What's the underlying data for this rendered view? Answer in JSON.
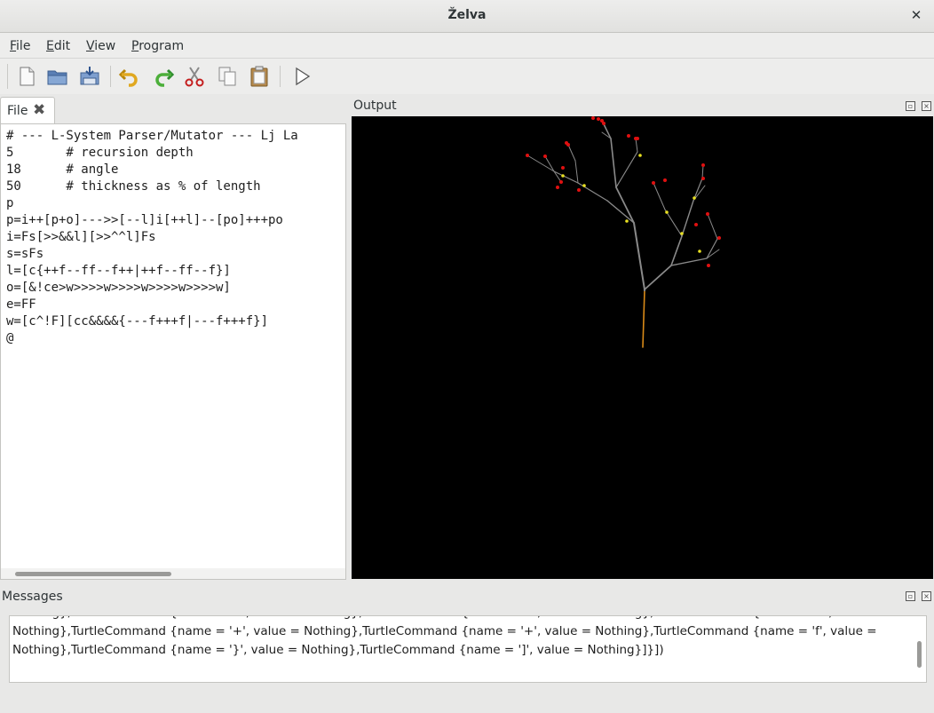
{
  "window": {
    "title": "Želva",
    "close_glyph": "✕"
  },
  "menu": [
    {
      "label": "File",
      "mnemonic": "F",
      "rest": "ile"
    },
    {
      "label": "Edit",
      "mnemonic": "E",
      "rest": "dit"
    },
    {
      "label": "View",
      "mnemonic": "V",
      "rest": "iew"
    },
    {
      "label": "Program",
      "mnemonic": "P",
      "rest": "rogram"
    }
  ],
  "toolbar": {
    "buttons": [
      "new-file-icon",
      "open-folder-icon",
      "save-icon",
      "undo-icon",
      "redo-icon",
      "cut-icon",
      "copy-icon",
      "paste-icon",
      "run-icon"
    ]
  },
  "editor": {
    "tab_label": "File",
    "tab_close": "✖",
    "lines": [
      "# --- L-System Parser/Mutator --- Lj La",
      "5       # recursion depth",
      "18      # angle",
      "50      # thickness as % of length",
      "p",
      "p=i++[p+o]--->>[--l]i[++l]--[po]+++po",
      "i=Fs[>>&&l][>>^^l]Fs",
      "s=sFs",
      "l=[c{++f--ff--f++|++f--ff--f}]",
      "o=[&!ce>w>>>>w>>>>w>>>>w>>>>w]",
      "e=FF",
      "w=[c^!F][cc&&&&{---f+++f|---f+++f}]",
      "@"
    ]
  },
  "output": {
    "title": "Output"
  },
  "messages": {
    "title": "Messages",
    "lines": [
      "Nothing},TurtleCommand {name = '+', value = Nothing},TurtleCommand {name = '+', value = Nothing},TurtleCommand {name = 'f', value =",
      "Nothing},TurtleCommand {name = '}', value = Nothing},TurtleCommand {name = ']', value = Nothing}]}])"
    ]
  },
  "colors": {
    "trunk": "#d98a18",
    "branch": "#8a8a8a",
    "joint": "#e8e020",
    "tip": "#e01010",
    "canvas": "#000000"
  }
}
